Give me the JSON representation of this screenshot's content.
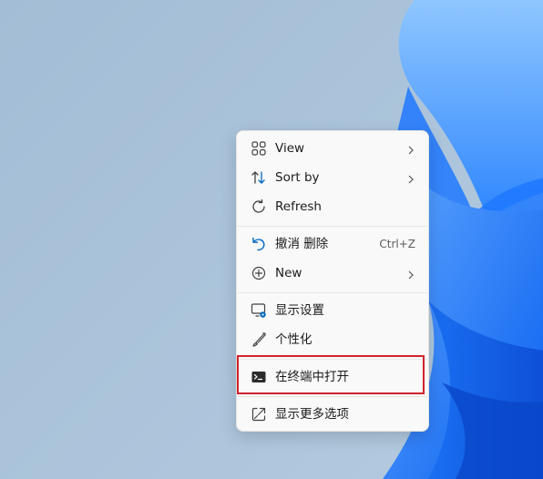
{
  "context_menu": {
    "items": [
      {
        "label": "View",
        "icon": "view-grid-icon",
        "submenu": true
      },
      {
        "label": "Sort by",
        "icon": "sort-icon",
        "submenu": true
      },
      {
        "label": "Refresh",
        "icon": "refresh-icon"
      },
      {
        "label": "撤消 删除",
        "icon": "undo-icon",
        "shortcut": "Ctrl+Z"
      },
      {
        "label": "New",
        "icon": "add-circle-icon",
        "submenu": true
      },
      {
        "label": "显示设置",
        "icon": "display-settings-icon"
      },
      {
        "label": "个性化",
        "icon": "brush-icon"
      },
      {
        "label": "在终端中打开",
        "icon": "terminal-icon",
        "highlighted": true
      },
      {
        "label": "显示更多选项",
        "icon": "open-external-icon"
      }
    ]
  },
  "colors": {
    "accent": "#0067c0",
    "highlight_border": "#d0222b",
    "menu_background": "#f9f9f9",
    "wallpaper_bloom": "#1a73ff"
  }
}
